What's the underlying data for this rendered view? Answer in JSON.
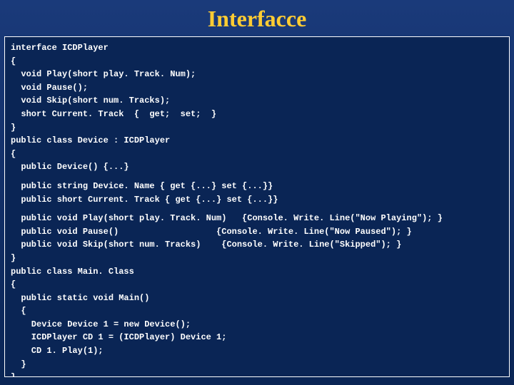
{
  "title": "Interfacce",
  "code": {
    "l01": "interface ICDPlayer",
    "l02": "{",
    "l03": "  void Play(short play. Track. Num);",
    "l04": "  void Pause();",
    "l05": "  void Skip(short num. Tracks);",
    "l06": "  short Current. Track  {  get;  set;  }",
    "l07": "}",
    "l08": "public class Device : ICDPlayer",
    "l09": "{",
    "l10": "  public Device() {...}",
    "l11": "  public string Device. Name { get {...} set {...}}",
    "l12": "  public short Current. Track { get {...} set {...}}",
    "l13": "  public void Play(short play. Track. Num)   {Console. Write. Line(\"Now Playing\"); }",
    "l14": "  public void Pause()                   {Console. Write. Line(\"Now Paused\"); }",
    "l15": "  public void Skip(short num. Tracks)    {Console. Write. Line(\"Skipped\"); }",
    "l16": "}",
    "l17": "public class Main. Class",
    "l18": "{",
    "l19": "  public static void Main()",
    "l20": "  {",
    "l21": "    Device Device 1 = new Device();",
    "l22": "    ICDPlayer CD 1 = (ICDPlayer) Device 1;",
    "l23": "    CD 1. Play(1);",
    "l24": "  }",
    "l25": "}"
  }
}
